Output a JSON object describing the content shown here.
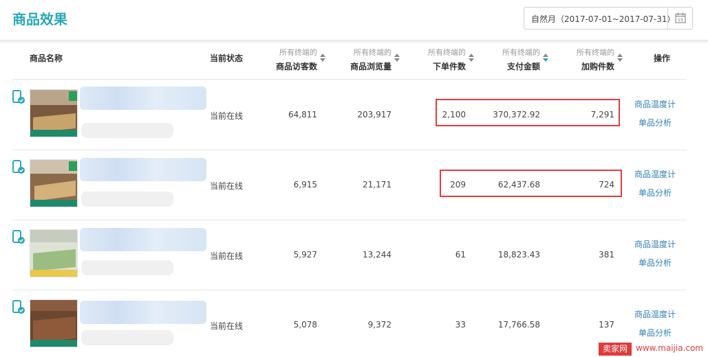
{
  "page": {
    "title": "商品效果"
  },
  "date_picker": {
    "label": "自然月（2017-07-01~2017-07-31）",
    "calendar_day": "15"
  },
  "columns": {
    "name": "商品名称",
    "status": "当前状态",
    "visitors": {
      "sub": "所有终端的",
      "main": "商品访客数"
    },
    "views": {
      "sub": "所有终端的",
      "main": "商品浏览量"
    },
    "orders": {
      "sub": "所有终端的",
      "main": "下单件数"
    },
    "payment": {
      "sub": "所有终端的",
      "main": "支付金额"
    },
    "cart": {
      "sub": "所有终端的",
      "main": "加购件数"
    },
    "actions": "操作"
  },
  "rows": [
    {
      "status": "当前在线",
      "visitors": "64,811",
      "views": "203,917",
      "orders": "2,100",
      "payment": "370,372.92",
      "cart": "7,291",
      "action1": "商品温度计",
      "action2": "单品分析",
      "highlighted": true
    },
    {
      "status": "当前在线",
      "visitors": "6,915",
      "views": "21,171",
      "orders": "209",
      "payment": "62,437.68",
      "cart": "724",
      "action1": "商品温度计",
      "action2": "单品分析",
      "highlighted": true
    },
    {
      "status": "当前在线",
      "visitors": "5,927",
      "views": "13,244",
      "orders": "61",
      "payment": "18,823.43",
      "cart": "381",
      "action1": "商品温度计",
      "action2": "单品分析",
      "highlighted": false
    },
    {
      "status": "当前在线",
      "visitors": "5,078",
      "views": "9,372",
      "orders": "33",
      "payment": "17,766.58",
      "cart": "137",
      "action1": "商品温度计",
      "action2": "单品分析",
      "highlighted": false
    }
  ],
  "watermark": {
    "logo": "卖家网",
    "url": "www.maijia.com"
  },
  "colors": {
    "accent": "#2aa8b5",
    "link": "#2f7fb8",
    "highlight": "#e23b3b"
  }
}
